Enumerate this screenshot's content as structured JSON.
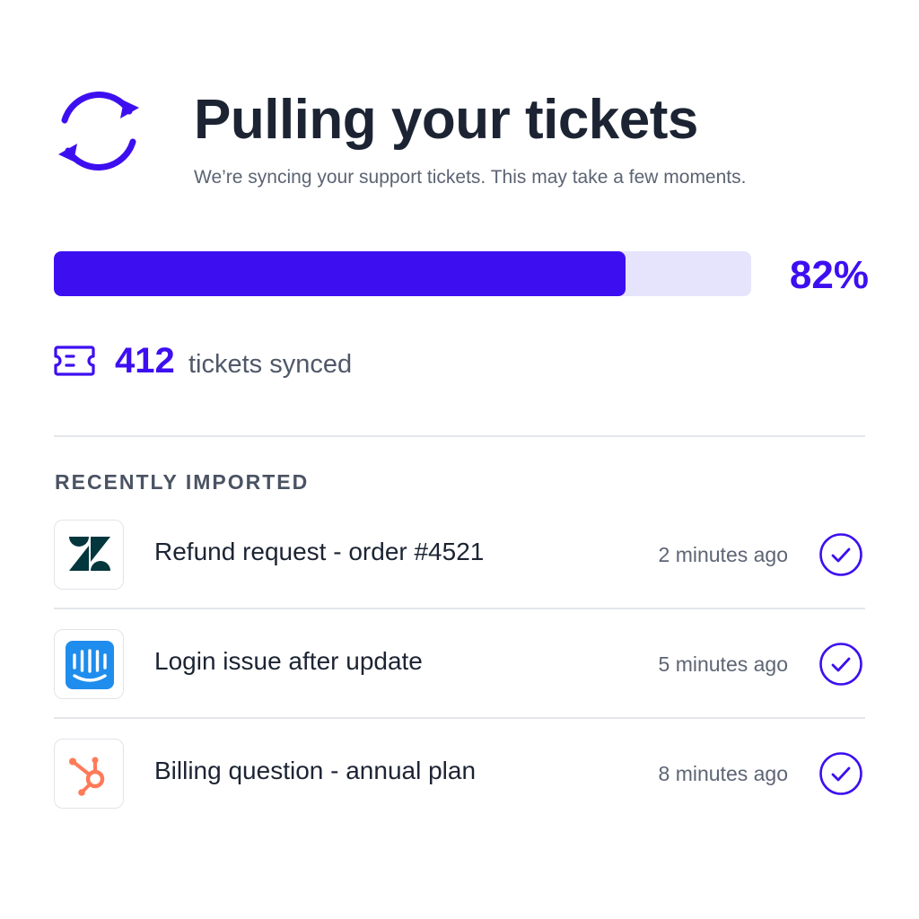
{
  "header": {
    "title": "Pulling your tickets",
    "subtitle": "We’re syncing your support tickets. This may take a few moments.",
    "icon": "sync-icon"
  },
  "progress": {
    "percent": 82,
    "label": "82%"
  },
  "summary": {
    "icon": "ticket-icon",
    "count": "412",
    "label": "tickets synced"
  },
  "recent": {
    "heading": "RECENTLY IMPORTED",
    "items": [
      {
        "source_icon": "zendesk-logo-icon",
        "title": "Refund request - order #4521",
        "time": "2 minutes ago",
        "status_icon": "check-circle-icon"
      },
      {
        "source_icon": "intercom-logo-icon",
        "title": "Login issue after update",
        "time": "5 minutes ago",
        "status_icon": "check-circle-icon"
      },
      {
        "source_icon": "hubspot-logo-icon",
        "title": "Billing question - annual plan",
        "time": "8 minutes ago",
        "status_icon": "check-circle-icon"
      }
    ]
  },
  "colors": {
    "accent": "#3d0ff0",
    "track": "#e6e3fc",
    "zendesk": "#03363d",
    "intercom": "#1f8ded",
    "hubspot": "#ff7a59"
  }
}
